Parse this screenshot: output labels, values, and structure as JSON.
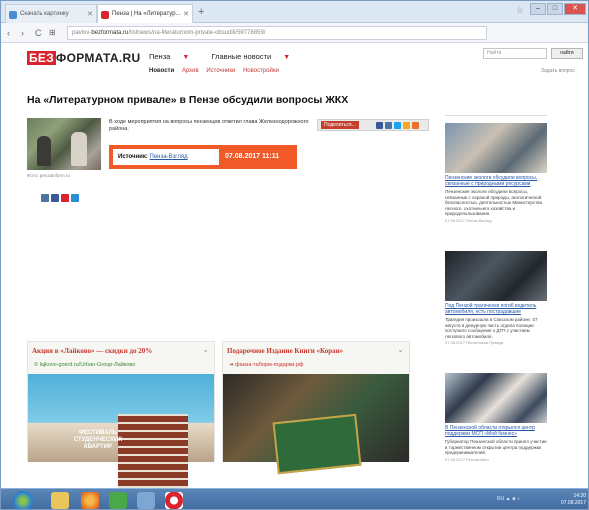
{
  "browser": {
    "tabs": [
      {
        "label": "Скачать картинку",
        "active": false
      },
      {
        "label": "Пенза | На «Литератур...",
        "active": true
      }
    ],
    "url_prefix": "pavlov-",
    "url_domain": "bezformata.ru",
    "url_rest": "/listnews/na-literaturnom-privale-obsudili/59778859/"
  },
  "site": {
    "logo_red": "БЕЗ",
    "logo_black": "ФОРМАТА.RU",
    "nav": [
      "Пенза",
      "Главные новости"
    ],
    "subnav": [
      "Новости",
      "Архив",
      "Источники",
      "Новостройки"
    ],
    "search_placeholder": "Найти",
    "search_button": "найти",
    "top_link": "Задать вопрос"
  },
  "article": {
    "title": "На «Литературном привале» в Пензе обсудили вопросы ЖКХ",
    "lead": "В ходе мероприятия на вопросы пензенцев ответил глава Железнодорожного района.",
    "photo_caption": "Фото: penzainform.ru",
    "share_label": "Поделиться...",
    "source_label": "Источник:",
    "source_name": "Пенза-Взгляд",
    "date": "07.08.2017 11:11"
  },
  "ads": [
    {
      "headline": "Акция в «Лайково» — скидки до 20%",
      "subline": "© lajkovo-gosrd.ru/Urban-Group-Лайково",
      "image_text": "ФЕСТИВАЛЬ СТУДЕНЧЕСКИХ КВАРТИР"
    },
    {
      "headline": "Подарочное Издание Книги «Коран»",
      "subline": "➜ фаиза-таборм-подарки.рф"
    }
  ],
  "sidebar": [
    {
      "headline": "Пензенские экологи обсудили вопросы, связанные с природными ресурсами",
      "text": "Пензенские экологи обсудили вопросы, связанные с охраной природы, экологической безопасностью, деятельностью Министерства лесного, охотничьего хозяйства и природопользования.",
      "meta": "07.08.2017 Пенза-Взгляд"
    },
    {
      "headline": "Под Пензой трагически погиб водитель автомобиля, есть пострадавшие",
      "text": "Трагедия произошла в Спасском районе. 07 августа в дежурную часть отдела полиции поступило сообщение о ДТП с участием легкового автомобиля.",
      "meta": "07.08.2017 Пензенская Правда"
    },
    {
      "headline": "В Пензенской области открылся центр поддержки МСП «Мой бизнес»",
      "text": "Губернатор Пензенской области принял участие в торжественном открытии центра поддержки предпринимателей.",
      "meta": "07.08.2017 Penzainform"
    }
  ],
  "taskbar": {
    "clock_time": "14:20",
    "clock_date": "07.08.2017",
    "lang": "RU"
  },
  "colors": {
    "accent": "#d9232d",
    "source_box": "#f05a28",
    "link": "#2a58a8",
    "taskbar": "#3f6a9e"
  }
}
